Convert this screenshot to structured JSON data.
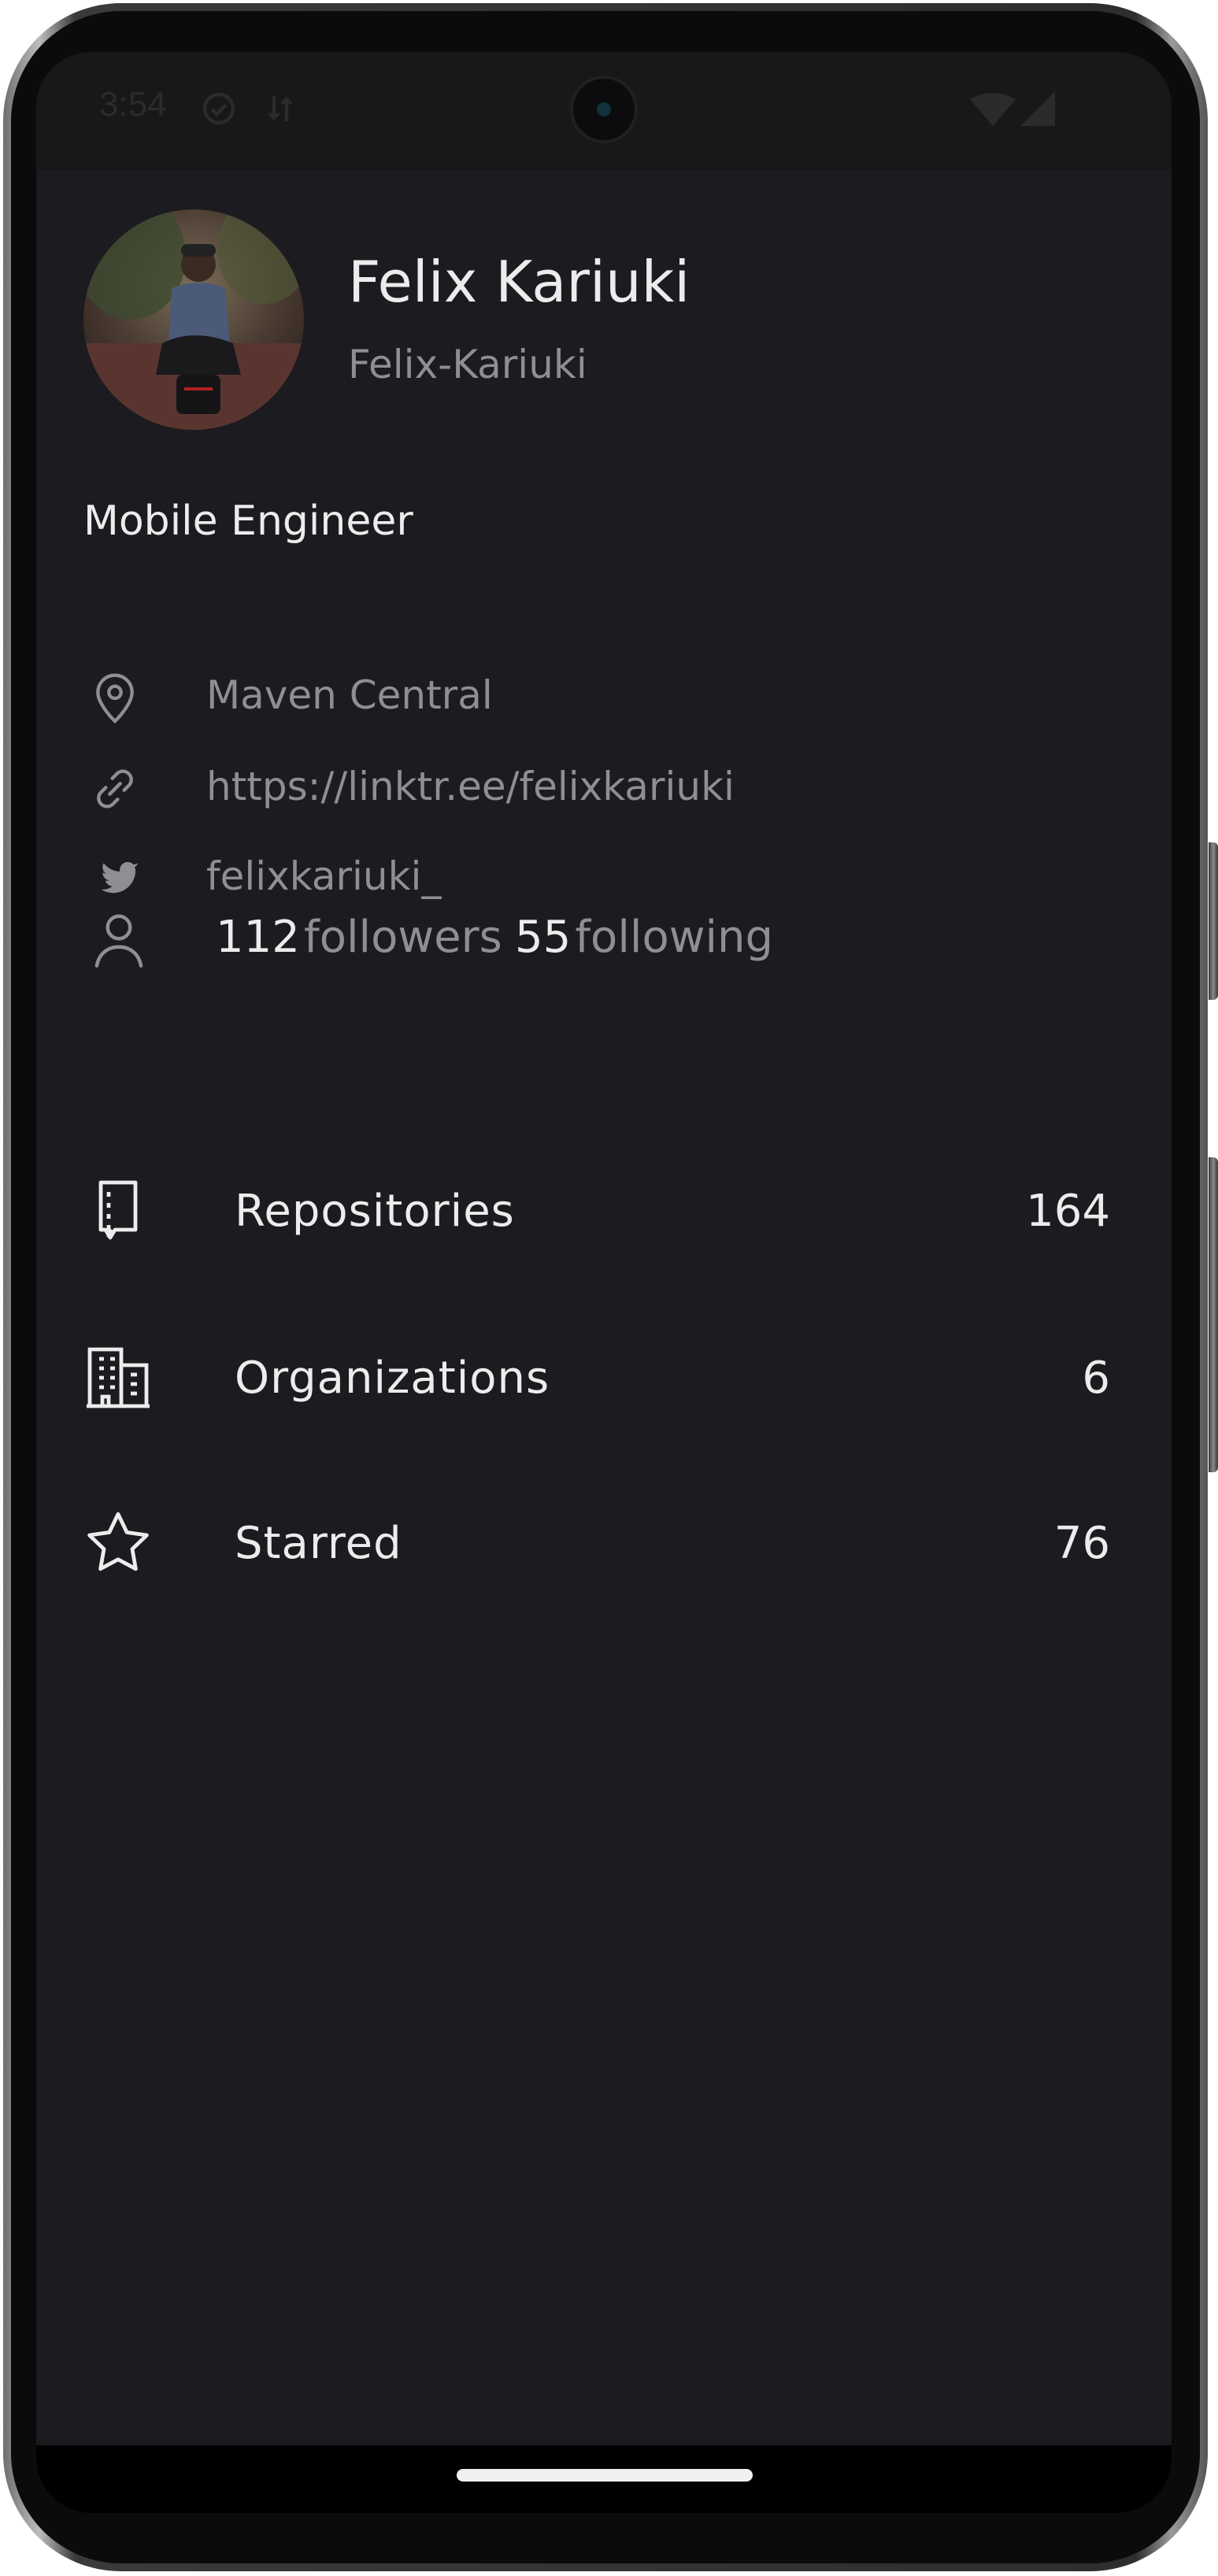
{
  "status_bar": {
    "time": "3:54",
    "icons": [
      "check-circle-icon",
      "sync-icon",
      "wifi-icon",
      "cellular-signal-icon"
    ]
  },
  "profile": {
    "name": "Felix Kariuki",
    "login": "Felix-Kariuki",
    "bio": "Mobile Engineer",
    "location": "Maven Central",
    "blog": "https://linktr.ee/felixkariuki",
    "twitter": "felixkariuki_",
    "followers_count": "112",
    "followers_label": "followers",
    "following_count": "55",
    "following_label": "following"
  },
  "menu": {
    "items": [
      {
        "label": "Repositories",
        "count": "164",
        "icon": "repository-icon"
      },
      {
        "label": "Organizations",
        "count": "6",
        "icon": "organization-icon"
      },
      {
        "label": "Starred",
        "count": "76",
        "icon": "star-icon"
      }
    ]
  },
  "colors": {
    "background": "#1c1b1f",
    "primary_text": "#ececec",
    "secondary_text": "#8f8f93"
  }
}
